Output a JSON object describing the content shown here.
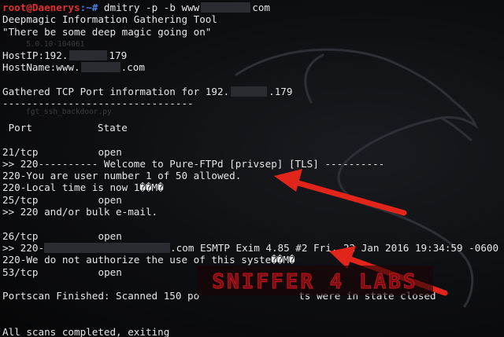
{
  "prompt": {
    "user_host": "root@Daenerys",
    "path": ":~#",
    "command_prefix": "dmitry -p -b www",
    "command_suffix": "com"
  },
  "lines": {
    "tool_name": "Deepmagic Information Gathering Tool",
    "tagline": "\"There be some deep magic going on\"",
    "hostip_prefix": "HostIP:192.",
    "hostip_suffix": "179",
    "hostname_prefix": "HostName:www.",
    "hostname_suffix": ".com",
    "gathered_prefix": "Gathered TCP Port information for 192.",
    "gathered_suffix": ".179",
    "separator": "--------------------------------",
    "header_port": " Port",
    "header_state": "State",
    "port21": "21/tcp",
    "port21_state": "open",
    "ftp_banner": ">> 220---------- Welcome to Pure-FTPd [privsep] [TLS] ----------",
    "ftp_user": "220-You are user number 1 of 50 allowed.",
    "ftp_time": "220-Local time is now 1��M�",
    "port25": "25/tcp",
    "port25_state": "open",
    "smtp_bulk": ">> 220 and/or bulk e-mail.",
    "port26": "26/tcp",
    "port26_state": "open",
    "exim_prefix": ">> 220-",
    "exim_suffix": ".com ESMTP Exim 4.85 #2 Fri, 22 Jan 2016 19:34:59 -0600",
    "exim_authorize": "220-We do not authorize the use of this syste��M�",
    "port53": "53/tcp",
    "port53_state": "open",
    "portscan_prefix": "Portscan Finished: Scanned 150 po",
    "portscan_suffix": "ts were in state closed",
    "completed": "All scans completed, exiting"
  },
  "background": {
    "ghost_version": "5.0.10-104061",
    "ghost_file": "fgt_ssh_backdoor.py"
  },
  "watermark": {
    "text": "SNIFFER 4 LABS"
  },
  "colors": {
    "prompt_user": "#e0312b",
    "prompt_path": "#4d7fe0",
    "text": "#e6e6e6",
    "arrow": "#e1251b",
    "background": "#0d0e11"
  }
}
